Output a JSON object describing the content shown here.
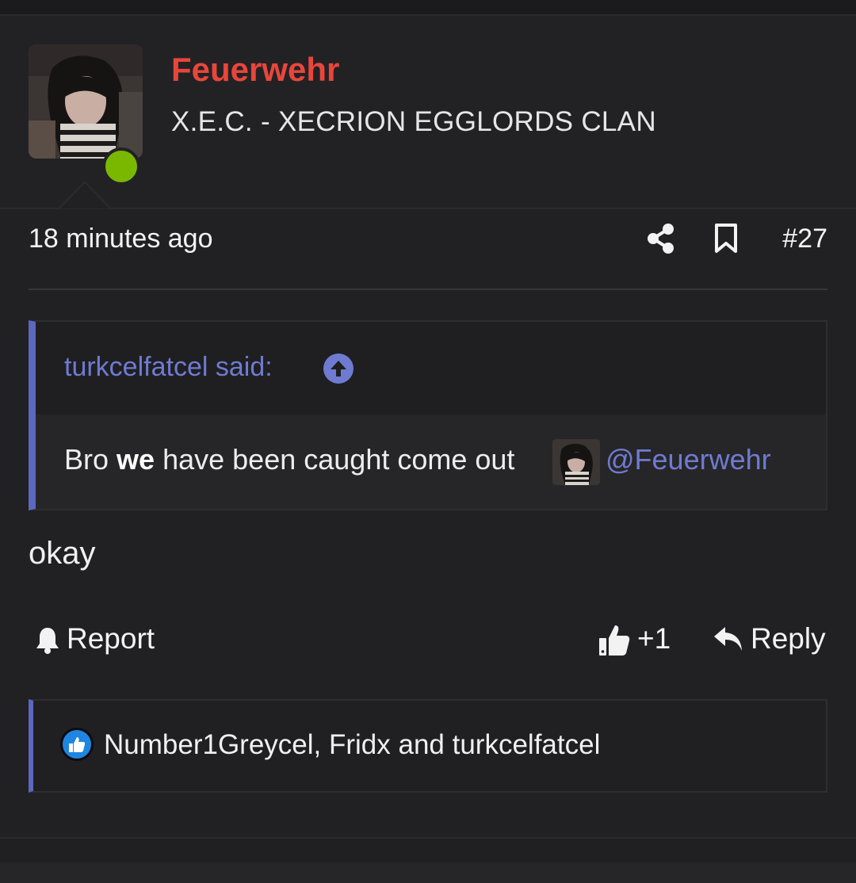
{
  "post": {
    "username": "Feuerwehr",
    "user_title": "X.E.C. - XECRION EGGLORDS CLAN",
    "online_status": "online",
    "timestamp": "18 minutes ago",
    "post_number": "#27",
    "quote": {
      "author": "turkcelfatcel said:",
      "text_before": "Bro",
      "text_bold": "we",
      "text_after": "have been caught come out",
      "mention": "@Feuerwehr"
    },
    "message": "okay",
    "actions": {
      "report_label": "Report",
      "like_count": "+1",
      "reply_label": "Reply"
    },
    "reactions": {
      "names": "Number1Greycel, Fridx and turkcelfatcel"
    }
  },
  "icons": {
    "share": "share-icon",
    "bookmark": "bookmark-icon",
    "expand": "arrow-up-circle-icon",
    "report": "bell-icon",
    "like": "thumbs-up-icon",
    "reply": "reply-arrow-icon",
    "reaction": "like-badge-icon"
  },
  "colors": {
    "background": "#202022",
    "username": "#e8463b",
    "accent": "#6f7bd1",
    "quote_border": "#5c67c0",
    "online": "#7ab800",
    "like_badge": "#1e86e0"
  }
}
